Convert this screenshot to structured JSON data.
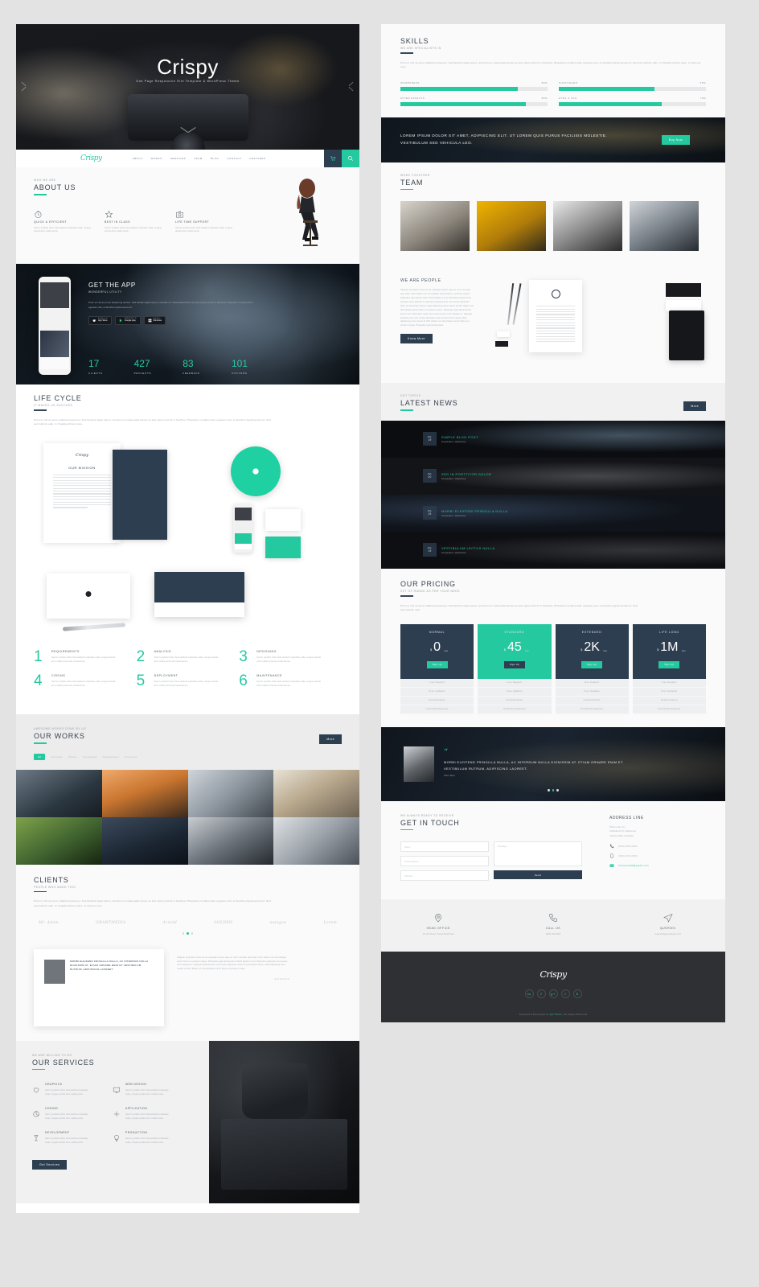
{
  "hero": {
    "title": "Crispy",
    "subtitle": "One Page Responsive Site Template & WordPress Theme"
  },
  "nav": {
    "logo": "Crispy",
    "links": [
      "ABOUT",
      "WORKS",
      "SERVICES",
      "TEAM",
      "BLOG",
      "CONTACT",
      "FEATURES"
    ],
    "cart_icon": "cart-icon",
    "search_icon": "search-icon"
  },
  "about": {
    "eyebrow": "WHO WE ARE",
    "title": "ABOUT US",
    "features": [
      {
        "icon": "clock-icon",
        "title": "QUICK & EFFICIENT",
        "text": "Sed in porttitor dolor Sed eleifend vulputate nulla, congue iaculis arcu mattis porta."
      },
      {
        "icon": "star-icon",
        "title": "BEST IN CLASS",
        "text": "Sed in porttitor dolor Sed eleifend vulputate nulla, congue iaculis arcu mattis porta."
      },
      {
        "icon": "camera-icon",
        "title": "LIFE TIME SUPPORT",
        "text": "Sed in porttitor dolor Sed eleifend vulputate nulla, congue iaculis arcu mattis porta."
      }
    ]
  },
  "app": {
    "title": "GET THE APP",
    "subtitle": "WONDERFUL UTILITY",
    "text": "Proin at nisl ac purus adipiscing laoreet. Sed facilisis ligula ipsum, interdum et malesuada fames ac ante ipsum primis in faucibus. Phasellus condimentum egestas velit, et faucibus ligula laoreet id.",
    "stores": [
      {
        "top": "App Store",
        "sub": "Available on the"
      },
      {
        "top": "Google play",
        "sub": "ANDROID APP ON"
      },
      {
        "top": "Windows",
        "sub": "Available on"
      }
    ],
    "counters": [
      {
        "num": "17",
        "label": "CLIENTS"
      },
      {
        "num": "427",
        "label": "PROJECTS"
      },
      {
        "num": "83",
        "label": "FEEDBACK"
      },
      {
        "num": "101",
        "label": "VISITORS"
      }
    ]
  },
  "lifecycle": {
    "title": "LIFE CYCLE",
    "eyebrow": "IT MAKES US SUCCESS",
    "text": "Proin in nisl ac purus adipiscing laoreet. Sed facilisis ligula ipsum, interdum et malesuada fames ac ante ipsum primis in faucibus. Phasellus condimentum egestas velit, et faucibus ligula laoreet id. Sed sed lobortis odio. In fringilla ultrices justo.",
    "doc_logo": "Crispy",
    "doc_title": "OUR MISSION",
    "steps": [
      {
        "n": "1",
        "title": "REQUIREMENTS",
        "text": "Sed in porttitor dolor Sed eleifend vulputate nulla, congue iaculis arcu mattis porta sed vehicula leo."
      },
      {
        "n": "2",
        "title": "ANALYSIS",
        "text": "Sed in porttitor dolor Sed eleifend vulputate nulla, congue iaculis arcu mattis porta sed vehicula leo."
      },
      {
        "n": "3",
        "title": "DESIGNING",
        "text": "Sed in porttitor dolor Sed eleifend vulputate nulla, congue iaculis arcu mattis porta sed vehicula leo."
      },
      {
        "n": "4",
        "title": "CODING",
        "text": "Sed in porttitor dolor Sed eleifend vulputate nulla, congue iaculis arcu mattis porta sed vehicula leo."
      },
      {
        "n": "5",
        "title": "DEPLOYMENT",
        "text": "Sed in porttitor dolor Sed eleifend vulputate nulla, congue iaculis arcu mattis porta sed vehicula leo."
      },
      {
        "n": "6",
        "title": "MAINTENANCE",
        "text": "Sed in porttitor dolor Sed eleifend vulputate nulla, congue iaculis arcu mattis porta sed vehicula leo."
      }
    ]
  },
  "works": {
    "eyebrow": "AWESOME WORKS DONE BY US",
    "title": "OUR WORKS",
    "more_label": "More",
    "filters": [
      "All",
      "Identities",
      "Photos",
      "Typography",
      "Development",
      "Corporate"
    ],
    "active_filter": "All"
  },
  "clients": {
    "title": "CLIENTS",
    "eyebrow": "PEOPLE WHO MADE THIS",
    "text": "Proin in nisl ac purus adipiscing laoreet. Sed facilisis ligula ipsum, interdum et malesuada fames ac ante ipsum primis in faucibus. Phasellus condimentum egestas velit, et faucibus ligula laoreet id. Sed sed lobortis odio. In fringilla ultrices justo, ut rhoncus eros.",
    "logos": [
      "Mr. Adam",
      "GRANTMEDIA",
      "Arnold",
      "GOLDEN",
      "assagon",
      "Lorem"
    ],
    "quote": "MORBI ELEIFEND FRINGILLA NULLA, AC INTERDUM NULLA DIGNISSIM AT. ETIAM ORNARE ENIM ET VESTIBULUM RUTRUM, ADIPISCING LAOREET.",
    "quote_author": "GOLDGOLD",
    "testimonial_text": "Aliquam at pretium risus ac est voluptae tempor eget eu nunc. Aenean quis dolor nunc. Etiam non dui tristique auctor libero et pretium neque. Phasellus eget lacinia dolor. Morbi ligula ut nunc bibendum placerat vel posuere enim aliquam a. Quisque pharetra arcu sed ornare dignissim dolor sit elementum lacus, vitae adipiscing urna mauris id nibh. Etiam non dui tristique auctor libero et pretium neque.",
    "testimonial_author": "GOLDGOLD"
  },
  "services": {
    "eyebrow": "WE ARE WILLING TO DO",
    "title": "OUR SERVICES",
    "items": [
      {
        "icon": "heart-icon",
        "title": "GRAPHICS",
        "text": "Sed in porttitor dolor Sed eleifend vulputate nulla, congue iaculis arcu mattis porta."
      },
      {
        "icon": "monitor-icon",
        "title": "WEB DESIGN",
        "text": "Sed in porttitor dolor Sed eleifend vulputate nulla, congue iaculis arcu mattis porta."
      },
      {
        "icon": "chart-icon",
        "title": "CODING",
        "text": "Sed in porttitor dolor Sed eleifend vulputate nulla, congue iaculis arcu mattis porta."
      },
      {
        "icon": "plus-icon",
        "title": "APPLICATION",
        "text": "Sed in porttitor dolor Sed eleifend vulputate nulla, congue iaculis arcu mattis porta."
      },
      {
        "icon": "glass-icon",
        "title": "DEVELOPMENT",
        "text": "Sed in porttitor dolor Sed eleifend vulputate nulla, congue iaculis arcu mattis porta."
      },
      {
        "icon": "bulb-icon",
        "title": "PRODUCTION",
        "text": "Sed in porttitor dolor Sed eleifend vulputate nulla, congue iaculis arcu mattis porta."
      }
    ],
    "cta_label": "Get Services"
  },
  "skills": {
    "title": "SKILLS",
    "eyebrow": "WE ARE SPECIALISTS IN",
    "text": "Proin in nisl ac purus adipiscing laoreet. Sed facilisis ligula ipsum, interdum et malesuada fames ac ante ipsum primis in faucibus. Phasellus condimentum egestas velit, et faucibus ligula laoreet id. Sed sed lobortis odio. In fringilla ultrices justo, ut rhoncus eros.",
    "bars": [
      {
        "label": "WORDPRESS",
        "value": "80%",
        "pct": 80
      },
      {
        "label": "PHOTOSHOP",
        "value": "65%",
        "pct": 65
      },
      {
        "label": "AFTER EFFECTS",
        "value": "85%",
        "pct": 85
      },
      {
        "label": "HTML & CSS",
        "value": "70%",
        "pct": 70
      }
    ]
  },
  "cta": {
    "text": "LOREM IPSUM DOLOR SIT AMET, ADIPISCING ELIT. UT LOREM QUIS PURUS FACILISIS MOLESTIE. VESTIBULUM SED VEHICULA LEO.",
    "button": "Buy Now"
  },
  "team": {
    "eyebrow": "WORK TOGETHER",
    "title": "TEAM"
  },
  "people": {
    "title": "WE ARE PEOPLE",
    "text": "Aliquam at pretium risus ac est voluptae tempor eget eu nunc. Aenean quis dolor nunc. Etiam non dui tristique auctor libero et pretium neque. Phasellus eget lacinia dolor. Morbi ligula ut nunc bibendum placerat vel posuere enim aliquam a. Quisque pharetra arcu sed ornare dignissim dolor sit elementum lacus, vitae adipiscing urna mauris id nibh. Etiam non dui tristique auctor libero et pretium neque. Phasellus eget lacinia dolor ipsum nunc bibendum quam arcu sed posuere enim aliquam a. Quisque pharetra arcu sed ornare dignissim dolor sit elementum lacus vitae adipiscing urna mauris id nibh. Etiam non dui tristique auctor libero et pretium neque. Phasellus eget lacinia dolor.",
    "button": "Know More"
  },
  "news": {
    "eyebrow": "HOT TOPICS",
    "title": "LATEST NEWS",
    "more_label": "More",
    "posts": [
      {
        "month": "JUL",
        "day": "19",
        "title": "SIMPLE BLOG POST",
        "meta": "Corporate  |  Advertise"
      },
      {
        "month": "JUL",
        "day": "20",
        "title": "SED IN PORTTITOR DOLOR",
        "meta": "Corporate  |  Advertise"
      },
      {
        "month": "JUL",
        "day": "19",
        "title": "MORBI ELEIFEND FRINGILLA NULLA",
        "meta": "Corporate  |  Advertise"
      },
      {
        "month": "JUL",
        "day": "19",
        "title": "VESTIBULUM LECTUS NULLA",
        "meta": "Corporate  |  Advertise"
      }
    ]
  },
  "pricing": {
    "title": "OUR PRICING",
    "eyebrow": "SET OF RANGE AS PER YOUR NEED",
    "text": "Proin in nisl ac purus adipiscing laoreet. Sed facilisis ligula ipsum, interdum et malesuada fames ac ante ipsum primis in faucibus. Phasellus condimentum egestas velit, et faucibus ligula laoreet id. Sed sed lobortis odio.",
    "plans": [
      {
        "name": "NORMAL",
        "currency": "$",
        "amount": "0",
        "period": "/mo",
        "button": "Sign Up",
        "features": [
          "Live Support",
          "Free Updates",
          "Customization",
          "Unlimited Features"
        ]
      },
      {
        "name": "STANDARD",
        "currency": "$",
        "amount": "45",
        "period": "/mo",
        "button": "Sign Up",
        "features": [
          "Live Support",
          "Free Updates",
          "Customization",
          "Unlimited Features"
        ]
      },
      {
        "name": "EXTENDED",
        "currency": "$",
        "amount": "2K",
        "period": "/mo",
        "button": "Sign Up",
        "features": [
          "Live Support",
          "Free Updates",
          "Customization",
          "Unlimited Features"
        ]
      },
      {
        "name": "LIFE LONG",
        "currency": "$",
        "amount": "1M",
        "period": "/mo",
        "button": "Sign Up",
        "features": [
          "Live Support",
          "Free Updates",
          "Customization",
          "Unlimited Features"
        ]
      }
    ],
    "featured_index": 1
  },
  "quote": {
    "mark": "“",
    "text": "MORBI ELEIFEND FRINGILLA NULLA, AC INTERDUM NULLA DIGNISSIM AT. ETIAM ORNARE ENIM ET VESTIBULUM RUTRUM, ADIPISCING LAOREET.",
    "author": "John Doe"
  },
  "contact": {
    "eyebrow": "WE ALWAYS READY TO RECEIVE",
    "title": "GET IN TOUCH",
    "name_placeholder": "Name",
    "email_placeholder": "Email Address",
    "website_placeholder": "Website",
    "message_placeholder": "Message",
    "send_label": "Send",
    "address_title": "ADDRESS LINE",
    "address": "Photo Lane 12,\n2 Elizabeth St, Melbourne\nVictoria 3000, Australia",
    "phone": "(000) 000-0000",
    "mobile": "(000) 000-0000",
    "email": "thisismail02@gmail.com"
  },
  "offices": [
    {
      "icon": "pin-icon",
      "title": "HEAD OFFICE",
      "text": "4/6 4th Street, Forest Road Town"
    },
    {
      "icon": "phone-icon",
      "title": "CALL US",
      "text": "(000) 000-0000"
    },
    {
      "icon": "send-icon",
      "title": "QUERIES",
      "text": "support@agrinedesign.com"
    }
  ],
  "footer": {
    "logo": "Crispy",
    "socials": [
      "in",
      "f",
      "g+",
      "t",
      "b"
    ],
    "copyright_pre": "Designed & Developed by ",
    "copyright_brand": "AgriTheme",
    "copyright_post": "  |  All Rights Reserved"
  },
  "colors": {
    "accent": "#25c9a0",
    "dark": "#2d3e50",
    "text": "#50585f"
  }
}
